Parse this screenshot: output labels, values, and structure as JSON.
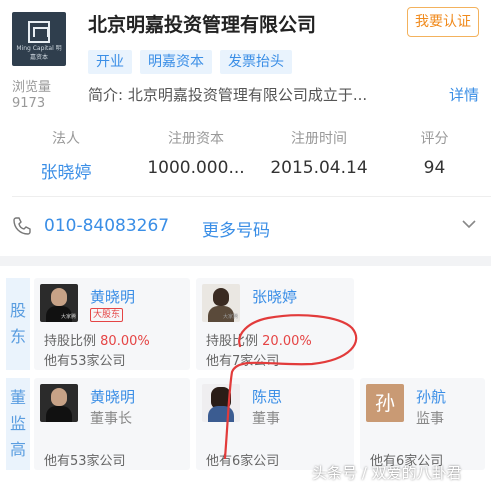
{
  "header": {
    "logo_text": "Ming Capital 明嘉资本",
    "company_name": "北京明嘉投资管理有限公司",
    "verify_button": "我要认证",
    "views_label": "浏览量",
    "views_count": "9173",
    "tags": [
      "开业",
      "明嘉资本",
      "发票抬头"
    ],
    "intro": "简介: 北京明嘉投资管理有限公司成立于...",
    "detail_link": "详情"
  },
  "info": {
    "legal_person_label": "法人",
    "legal_person": "张晓婷",
    "capital_label": "注册资本",
    "capital": "1000.000...",
    "reg_time_label": "注册时间",
    "reg_time": "2015.04.14",
    "score_label": "评分",
    "score": "94"
  },
  "contact": {
    "phone": "010-84083267",
    "more_numbers": "更多号码"
  },
  "shareholders": {
    "section_label": [
      "股",
      "东"
    ],
    "items": [
      {
        "name": "黄晓明",
        "badge": "大股东",
        "share_label": "持股比例",
        "share_pct": "80.00%",
        "others": "他有53家公司",
        "avatar_mark": "大家腾"
      },
      {
        "name": "张晓婷",
        "share_label": "持股比例",
        "share_pct": "20.00%",
        "others": "他有7家公司",
        "avatar_mark": "大家腾"
      }
    ]
  },
  "directors": {
    "section_label": [
      "董",
      "监",
      "高"
    ],
    "items": [
      {
        "name": "黄晓明",
        "role": "董事长",
        "others": "他有53家公司"
      },
      {
        "name": "陈思",
        "role": "董事",
        "others": "他有6家公司"
      },
      {
        "name": "孙航",
        "role": "监事",
        "others": "他有6家公司",
        "avatar_char": "孙"
      }
    ]
  },
  "watermark": "头条号 / 双爱的八卦君",
  "colors": {
    "link": "#3a8ee6",
    "accent_orange": "#f08a1c",
    "red": "#e54545",
    "tag_bg": "#e9f3fd"
  },
  "icons": [
    "phone-icon",
    "chevron-down-icon"
  ]
}
